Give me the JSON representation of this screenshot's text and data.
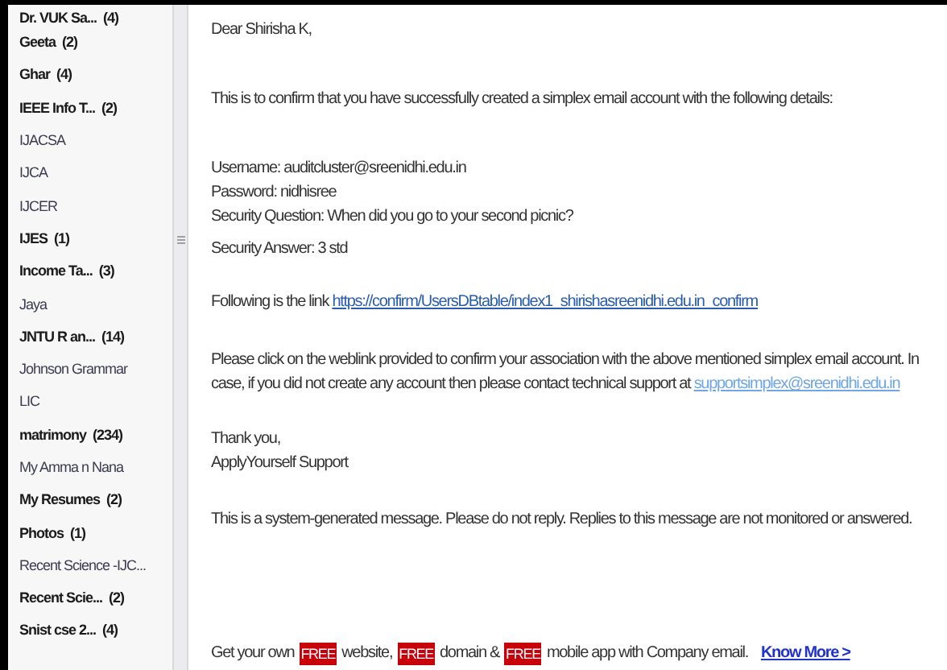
{
  "folders": [
    {
      "name": "Dr. VUK Sa...",
      "count": "(4)",
      "unread": true
    },
    {
      "name": "Geeta",
      "count": "(2)",
      "unread": true
    },
    {
      "name": "Ghar",
      "count": "(4)",
      "unread": true
    },
    {
      "name": "IEEE Info T...",
      "count": "(2)",
      "unread": true
    },
    {
      "name": "IJACSA",
      "unread": false
    },
    {
      "name": "IJCA",
      "unread": false
    },
    {
      "name": "IJCER",
      "unread": false
    },
    {
      "name": "IJES",
      "count": "(1)",
      "unread": true
    },
    {
      "name": "Income Ta...",
      "count": "(3)",
      "unread": true
    },
    {
      "name": "Jaya",
      "unread": false
    },
    {
      "name": "JNTU R an...",
      "count": "(14)",
      "unread": true
    },
    {
      "name": "Johnson Grammar",
      "unread": false
    },
    {
      "name": "LIC",
      "unread": false
    },
    {
      "name": "matrimony",
      "count": "(234)",
      "unread": true
    },
    {
      "name": "My Amma n Nana",
      "unread": false
    },
    {
      "name": "My Resumes",
      "count": "(2)",
      "unread": true
    },
    {
      "name": "Photos",
      "count": "(1)",
      "unread": true
    },
    {
      "name": "Recent Science -IJC...",
      "unread": false
    },
    {
      "name": "Recent Scie...",
      "count": "(2)",
      "unread": true
    },
    {
      "name": "Snist cse 2...",
      "count": "(4)",
      "unread": true
    }
  ],
  "message": {
    "greeting": "Dear Shirisha K,",
    "intro": "This is to confirm that you have successfully created a simplex email account with the following details:",
    "details": [
      "Username: auditcluster@sreenidhi.edu.in",
      "Password: nidhisree",
      "Security Question: When did you go to your second picnic?",
      "Security Answer: 3 std"
    ],
    "link_intro": "Following is the link",
    "link": "https://confirm/UsersDBtable/index1_shirishasreenidhi.edu.in_confirm",
    "instructions": "Please click on the weblink provided to confirm your association with the above mentioned simplex email account. In case, if you did not create any account then please contact technical support at",
    "support_email": "supportsimplex@sreenidhi.edu.in",
    "closing": [
      "Thank you,",
      "ApplyYourself Support"
    ],
    "notice": "This is a system-generated message. Please do not reply. Replies to this message are not monitored or answered."
  },
  "footer": {
    "parts": [
      {
        "kind": "text",
        "text": "Get your own"
      },
      {
        "kind": "badge",
        "text": "FREE"
      },
      {
        "kind": "text",
        "text": "website,"
      },
      {
        "kind": "badge",
        "text": "FREE"
      },
      {
        "kind": "text",
        "text": "domain &"
      },
      {
        "kind": "badge",
        "text": "FREE"
      },
      {
        "kind": "text",
        "text": "mobile app with Company email."
      },
      {
        "kind": "link",
        "text": "Know More >"
      }
    ]
  }
}
